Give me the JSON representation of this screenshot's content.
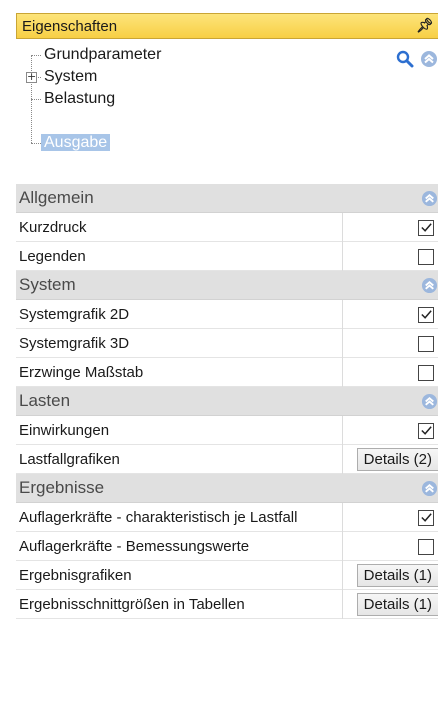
{
  "panel": {
    "title": "Eigenschaften",
    "pin_icon": "pin-icon"
  },
  "tree": {
    "items": [
      {
        "label": "Grundparameter"
      },
      {
        "label": "System",
        "expander": "+"
      },
      {
        "label": "Belastung"
      },
      {
        "label": "Ausgabe",
        "selected": true
      }
    ],
    "tools": {
      "search_icon": "search-icon",
      "collapse_icon": "collapse-all-icon"
    }
  },
  "grid": {
    "groups": [
      {
        "title": "Allgemein",
        "rows": [
          {
            "label": "Kurzdruck",
            "type": "checkbox",
            "checked": true
          },
          {
            "label": "Legenden",
            "type": "checkbox",
            "checked": false
          }
        ]
      },
      {
        "title": "System",
        "rows": [
          {
            "label": "Systemgrafik 2D",
            "type": "checkbox",
            "checked": true
          },
          {
            "label": "Systemgrafik 3D",
            "type": "checkbox",
            "checked": false
          },
          {
            "label": "Erzwinge Maßstab",
            "type": "checkbox",
            "checked": false
          }
        ]
      },
      {
        "title": "Lasten",
        "rows": [
          {
            "label": "Einwirkungen",
            "type": "checkbox",
            "checked": true
          },
          {
            "label": "Lastfallgrafiken",
            "type": "button",
            "button_label": "Details (2)"
          }
        ]
      },
      {
        "title": "Ergebnisse",
        "rows": [
          {
            "label": "Auflagerkräfte - charakteristisch je Lastfall",
            "type": "checkbox",
            "checked": true
          },
          {
            "label": "Auflagerkräfte - Bemessungswerte",
            "type": "checkbox",
            "checked": false
          },
          {
            "label": "Ergebnisgrafiken",
            "type": "button",
            "button_label": "Details (1)"
          },
          {
            "label": "Ergebnisschnittgrößen in Tabellen",
            "type": "button",
            "button_label": "Details (1)"
          }
        ]
      }
    ]
  },
  "colors": {
    "title_bar": "#f7cf45",
    "group_header": "#e0e0e0",
    "selection": "#a8c5e8",
    "accent_icon": "#2d6fd0"
  }
}
